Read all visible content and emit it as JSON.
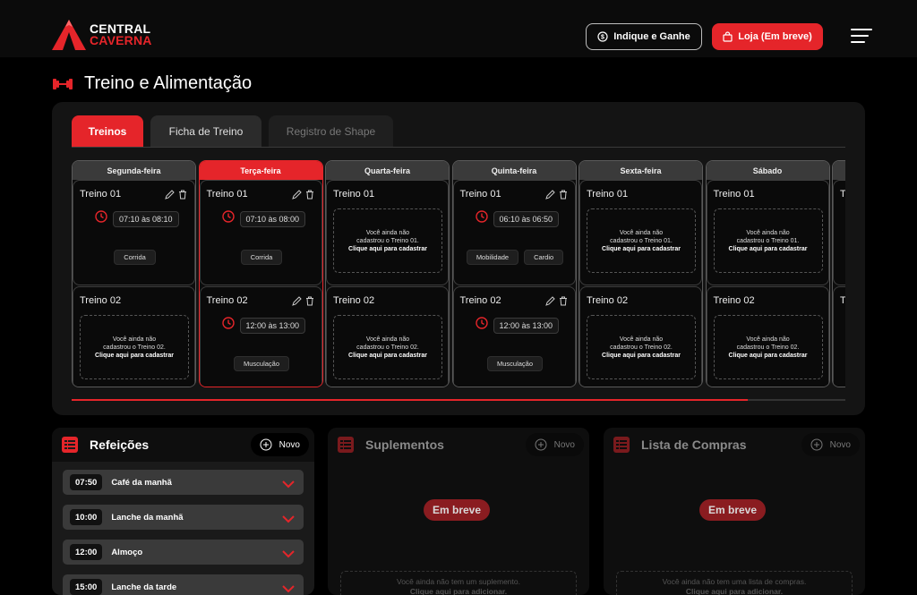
{
  "brand": {
    "line1": "CENTRAL",
    "line2": "CAVERNA"
  },
  "header": {
    "indique_label": "Indique e Ganhe",
    "loja_label": "Loja (Em breve)"
  },
  "page": {
    "title": "Treino e Alimentação"
  },
  "tabs": [
    {
      "label": "Treinos"
    },
    {
      "label": "Ficha de Treino"
    },
    {
      "label": "Registro de Shape"
    }
  ],
  "days": [
    {
      "name": "Segunda-feira",
      "t1": {
        "title": "Treino 01",
        "time": "07:10 às 08:10",
        "tags": [
          "Corrida"
        ]
      },
      "t2": {
        "title": "Treino 02",
        "empty": [
          "Você ainda não",
          "cadastrou o Treino 02.",
          "Clique aqui para cadastrar"
        ]
      }
    },
    {
      "name": "Terça-feira",
      "t1": {
        "title": "Treino 01",
        "time": "07:10 às 08:00",
        "tags": [
          "Corrida"
        ]
      },
      "t2": {
        "title": "Treino 02",
        "time": "12:00 às 13:00",
        "tags": [
          "Musculação"
        ]
      }
    },
    {
      "name": "Quarta-feira",
      "t1": {
        "title": "Treino 01",
        "empty": [
          "Você ainda não",
          "cadastrou o Treino 01.",
          "Clique aqui para cadastrar"
        ]
      },
      "t2": {
        "title": "Treino 02",
        "empty": [
          "Você ainda não",
          "cadastrou o Treino 02.",
          "Clique aqui para cadastrar"
        ]
      }
    },
    {
      "name": "Quinta-feira",
      "t1": {
        "title": "Treino 01",
        "time": "06:10 às 06:50",
        "tags": [
          "Mobilidade",
          "Cardio"
        ]
      },
      "t2": {
        "title": "Treino 02",
        "time": "12:00 às 13:00",
        "tags": [
          "Musculação"
        ]
      }
    },
    {
      "name": "Sexta-feira",
      "t1": {
        "title": "Treino 01",
        "empty": [
          "Você ainda não",
          "cadastrou o Treino 01.",
          "Clique aqui para cadastrar"
        ]
      },
      "t2": {
        "title": "Treino 02",
        "empty": [
          "Você ainda não",
          "cadastrou o Treino 02.",
          "Clique aqui para cadastrar"
        ]
      }
    },
    {
      "name": "Sábado",
      "t1": {
        "title": "Treino 01",
        "empty": [
          "Você ainda não",
          "cadastrou o Treino 01.",
          "Clique aqui para cadastrar"
        ]
      },
      "t2": {
        "title": "Treino 02",
        "empty": [
          "Você ainda não",
          "cadastrou o Treino 02.",
          "Clique aqui para cadastrar"
        ]
      }
    },
    {
      "name": "",
      "t1": {
        "title": "T"
      },
      "t2": {
        "title": "T"
      }
    }
  ],
  "refeicoes": {
    "title": "Refeições",
    "novo_label": "Novo",
    "items": [
      {
        "time": "07:50",
        "name": "Café da manhã"
      },
      {
        "time": "10:00",
        "name": "Lanche da manhã"
      },
      {
        "time": "12:00",
        "name": "Almoço"
      },
      {
        "time": "15:00",
        "name": "Lanche da tarde"
      }
    ]
  },
  "suplementos": {
    "title": "Suplementos",
    "novo_label": "Novo",
    "soon_label": "Em breve",
    "empty_line1": "Você ainda não tem um suplemento.",
    "empty_line2": "Clique aqui para adicionar."
  },
  "compras": {
    "title": "Lista de Compras",
    "novo_label": "Novo",
    "soon_label": "Em breve",
    "empty_line1": "Você ainda não tem uma lista de compras.",
    "empty_line2": "Clique aqui para adicionar."
  },
  "colors": {
    "accent": "#e5252a",
    "background": "#000000",
    "panel": "#141414"
  }
}
